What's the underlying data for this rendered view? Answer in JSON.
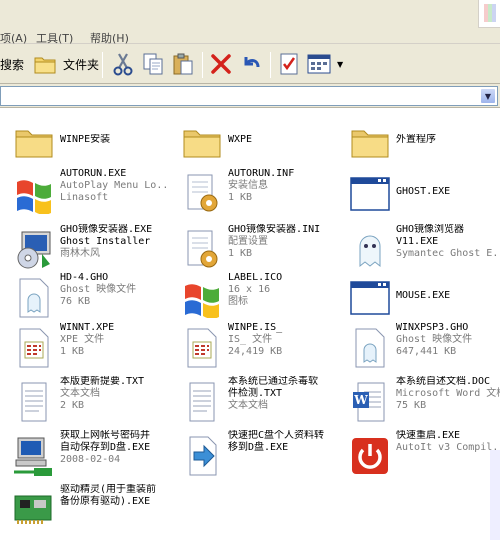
{
  "menu": {
    "view": "项(A)",
    "tools": "工具(T)",
    "help": "帮助(H)"
  },
  "toolbar": {
    "search": "搜索",
    "folders": "文件夹"
  },
  "files": [
    {
      "name": "WINPE安装",
      "icon": "folder-icon",
      "d1": "",
      "d2": ""
    },
    {
      "name": "WXPE",
      "icon": "folder-icon",
      "d1": "",
      "d2": ""
    },
    {
      "name": "外置程序",
      "icon": "folder-icon",
      "d1": "",
      "d2": ""
    },
    {
      "name": "AUTORUN.EXE",
      "icon": "windows-logo-icon",
      "d1": "AutoPlay Menu Lo...",
      "d2": "Linasoft"
    },
    {
      "name": "AUTORUN.INF",
      "icon": "config-file-icon",
      "d1": "安装信息",
      "d2": "1 KB"
    },
    {
      "name": "GHOST.EXE",
      "icon": "application-window-icon",
      "d1": "",
      "d2": ""
    },
    {
      "name": "GHO镜像安装器.EXE",
      "icon": "ghost-installer-icon",
      "d1": "Ghost Installer",
      "d2": "雨林木风"
    },
    {
      "name": "GHO镜像安装器.INI",
      "icon": "config-file-icon",
      "d1": "配置设置",
      "d2": "1 KB"
    },
    {
      "name": "GHO镜像浏览器",
      "icon": "ghost-icon",
      "d1": "V11.EXE",
      "d2": "Symantec Ghost E..."
    },
    {
      "name": "HD-4.GHO",
      "icon": "ghost-image-file-icon",
      "d1": "Ghost 映像文件",
      "d2": "76 KB"
    },
    {
      "name": "LABEL.ICO",
      "icon": "windows-logo-icon",
      "d1": "16 x 16",
      "d2": "图标"
    },
    {
      "name": "MOUSE.EXE",
      "icon": "application-window-icon",
      "d1": "",
      "d2": ""
    },
    {
      "name": "WINNT.XPE",
      "icon": "xpe-file-icon",
      "d1": "XPE 文件",
      "d2": "1 KB"
    },
    {
      "name": "WINPE.IS_",
      "icon": "xpe-file-icon",
      "d1": "IS_ 文件",
      "d2": "24,419 KB"
    },
    {
      "name": "WINXPSP3.GHO",
      "icon": "ghost-image-file-icon",
      "d1": "Ghost 映像文件",
      "d2": "647,441 KB"
    },
    {
      "name": "本版更新提要.TXT",
      "icon": "text-file-icon",
      "d1": "文本文档",
      "d2": "2 KB"
    },
    {
      "name": "本系统已通过杀毒软",
      "icon": "text-file-icon",
      "d1": "件检测.TXT",
      "d2": "文本文档"
    },
    {
      "name": "本系统自述文档.DOC",
      "icon": "word-document-icon",
      "d1": "Microsoft Word 文档",
      "d2": "75 KB"
    },
    {
      "name": "获取上网帐号密码并",
      "icon": "network-computer-icon",
      "d1": "自动保存到D盘.EXE",
      "d2": "2008-02-04"
    },
    {
      "name": "快速把C盘个人资料转",
      "icon": "move-arrow-file-icon",
      "d1": "移到D盘.EXE",
      "d2": ""
    },
    {
      "name": "快速重启.EXE",
      "icon": "power-restart-icon",
      "d1": "AutoIt v3 Compil...",
      "d2": ""
    },
    {
      "name": "驱动精灵(用于重装前",
      "icon": "driver-card-icon",
      "d1": "备份原有驱动).EXE",
      "d2": ""
    }
  ]
}
